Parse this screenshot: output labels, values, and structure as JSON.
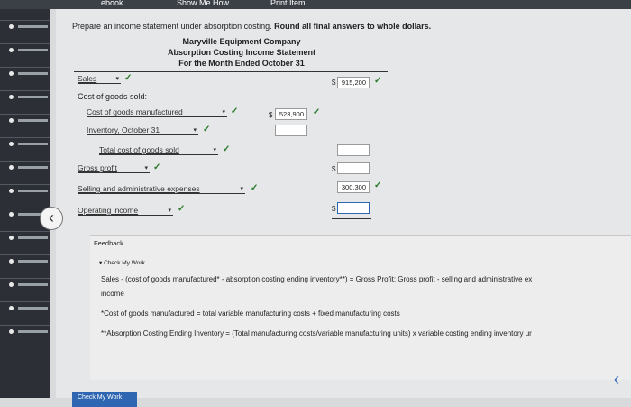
{
  "topbar": {
    "left_tab": "ebook",
    "show_me_how": "Show Me How",
    "print_item": "Print Item"
  },
  "instruction": {
    "prefix": "Prepare an income statement under absorption costing.",
    "emphasis": "Round all final answers to whole dollars."
  },
  "statement": {
    "company": "Maryville Equipment Company",
    "title": "Absorption Costing Income Statement",
    "period": "For the Month Ended October 31"
  },
  "rows": {
    "sales": {
      "label": "Sales",
      "value": "915,200"
    },
    "cogs_heading": "Cost of goods sold:",
    "cogm": {
      "label": "Cost of goods manufactured",
      "value": "523,900"
    },
    "inventory": {
      "label": "Inventory, October 31",
      "value": ""
    },
    "total_cogs": {
      "label": "Total cost of goods sold",
      "value": ""
    },
    "gross_profit": {
      "label": "Gross profit",
      "value": ""
    },
    "selling_admin": {
      "label": "Selling and administrative expenses",
      "value": "300,300"
    },
    "operating_income": {
      "label": "Operating income",
      "value": ""
    }
  },
  "currency_symbol": "$",
  "feedback": {
    "title": "Feedback",
    "check_my_work": "Check My Work",
    "line1": "Sales - (cost of goods manufactured* - absorption costing ending inventory**) = Gross Profit; Gross profit - selling and administrative ex",
    "line1b": "income",
    "line2": "*Cost of goods manufactured = total variable manufacturing costs + fixed manufacturing costs",
    "line3": "**Absorption Costing Ending Inventory = (Total manufacturing costs/variable manufacturing units) x variable costing ending inventory ur"
  },
  "bottom_tab": "Check My Work",
  "icons": {
    "back": "chevron-left-icon",
    "next": "chevron-right-icon",
    "check": "checkmark-icon",
    "dropdown": "dropdown-arrow-icon"
  },
  "colors": {
    "check": "#2b7a2b",
    "accent": "#2e66b2"
  }
}
